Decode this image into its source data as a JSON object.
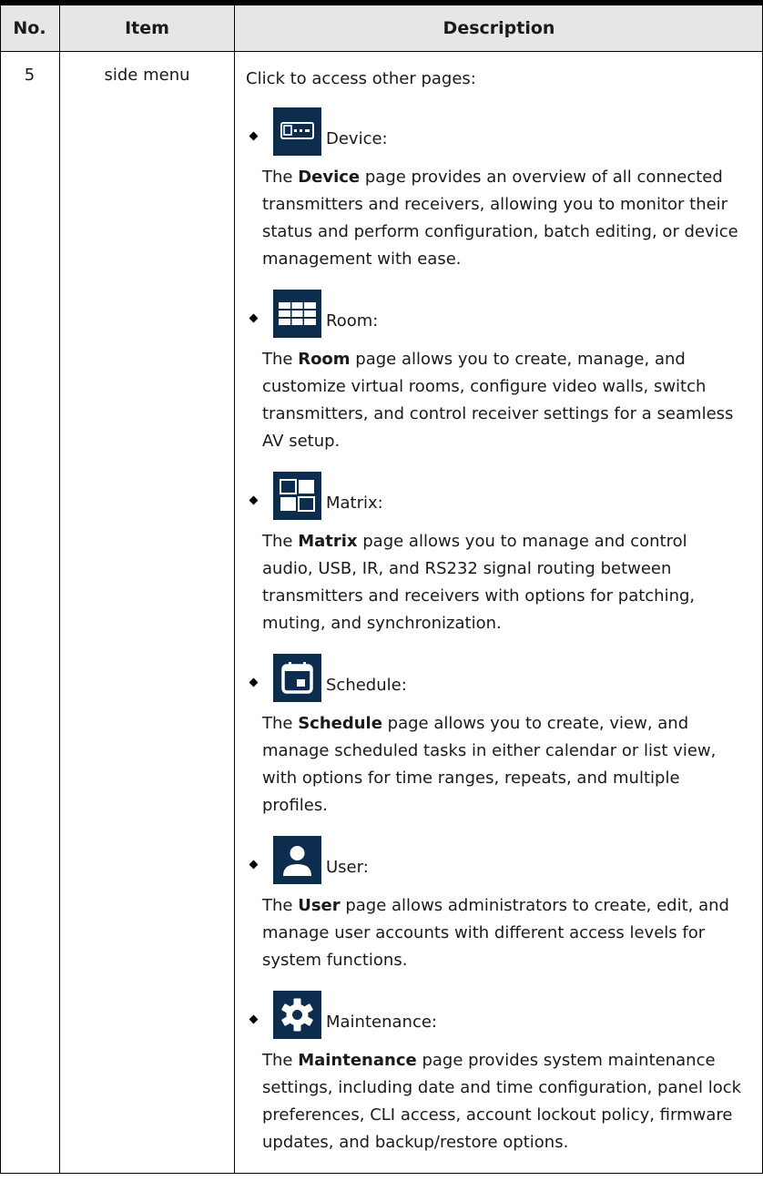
{
  "headers": {
    "no": "No.",
    "item": "Item",
    "description": "Description"
  },
  "row": {
    "no": "5",
    "item": "side menu",
    "intro": "Click to access other pages:",
    "entries": [
      {
        "icon": "device-icon",
        "label": "Device:",
        "bold": "Device",
        "pre": "The ",
        "post": " page provides an overview of all connected transmitters and receivers, allowing you to monitor their status and perform configuration, batch editing, or device management with ease."
      },
      {
        "icon": "room-icon",
        "label": "Room:",
        "bold": "Room",
        "pre": "The ",
        "post": " page allows you to create, manage, and customize virtual rooms, configure video walls, switch transmitters, and control receiver settings for a seamless AV setup."
      },
      {
        "icon": "matrix-icon",
        "label": "Matrix:",
        "bold": "Matrix",
        "pre": "The ",
        "post": " page allows you to manage and control audio, USB, IR, and RS232 signal routing between transmitters and receivers with options for patching, muting, and synchronization."
      },
      {
        "icon": "schedule-icon",
        "label": "Schedule:",
        "bold": "Schedule",
        "pre": "The ",
        "post": " page allows you to create, view, and manage scheduled tasks in either calendar or list view, with options for time ranges, repeats, and multiple profiles."
      },
      {
        "icon": "user-icon",
        "label": "User:",
        "bold": "User",
        "pre": "The ",
        "post": " page allows administrators to create, edit, and manage user accounts with different access levels for system functions."
      },
      {
        "icon": "gear-icon",
        "label": "Maintenance:",
        "bold": "Maintenance",
        "pre": "The ",
        "post": " page provides system maintenance settings, including date and time configuration, panel lock preferences, CLI access, account lockout policy, firmware updates, and backup/restore options."
      }
    ]
  },
  "colors": {
    "icon_bg": "#0c2d4e",
    "header_bg": "#e6e6e6"
  }
}
